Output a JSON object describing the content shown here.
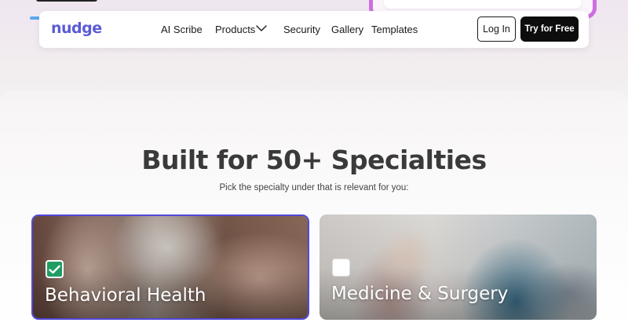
{
  "brand": {
    "logo_text": "nudge",
    "accent": "#5b5bd6"
  },
  "nav": {
    "links": [
      {
        "label": "AI Scribe"
      },
      {
        "label": "Products",
        "has_dropdown": true,
        "icon": "chevron-down-icon"
      },
      {
        "label": "Security"
      },
      {
        "label": "Gallery"
      },
      {
        "label": "Templates"
      }
    ],
    "login_label": "Log In",
    "cta_label": "Try for Free"
  },
  "hero": {
    "title": "Built for 50+ Specialties",
    "subtitle": "Pick the specialty under that is relevant for you:"
  },
  "specialties": [
    {
      "label": "Behavioral Health",
      "selected": true,
      "icon": "checkmark-icon",
      "border_color": "#5047d8",
      "check_color": "#1f9d63"
    },
    {
      "label": "Medicine & Surgery",
      "selected": false
    }
  ]
}
